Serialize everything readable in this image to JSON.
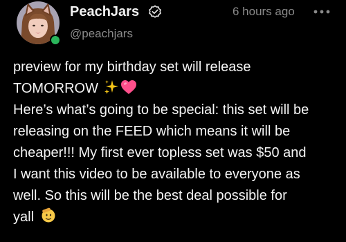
{
  "post": {
    "author": {
      "display_name": "PeachJars",
      "handle": "@peachjars",
      "verified": true,
      "online": true
    },
    "timestamp": "6 hours ago",
    "body_lines": [
      "preview for my birthday set will release",
      "TOMORROW",
      "Here’s what’s going to be special: this set will be",
      "releasing on the FEED which means it will be",
      "cheaper!!! My first ever topless set was $50 and",
      "I want this video to be available to everyone as",
      "well. So this will be the best deal possible for",
      "yall"
    ],
    "emoji": {
      "line2": [
        "sparkles-icon",
        "pink-heart-icon"
      ],
      "line8": [
        "saluting-face-icon"
      ]
    }
  },
  "colors": {
    "background": "#000000",
    "text": "#f4f4f4",
    "muted": "#8a8a8a",
    "online": "#2ab55b",
    "sparkles": "#f5c518",
    "heart": "#ff4f8b"
  }
}
